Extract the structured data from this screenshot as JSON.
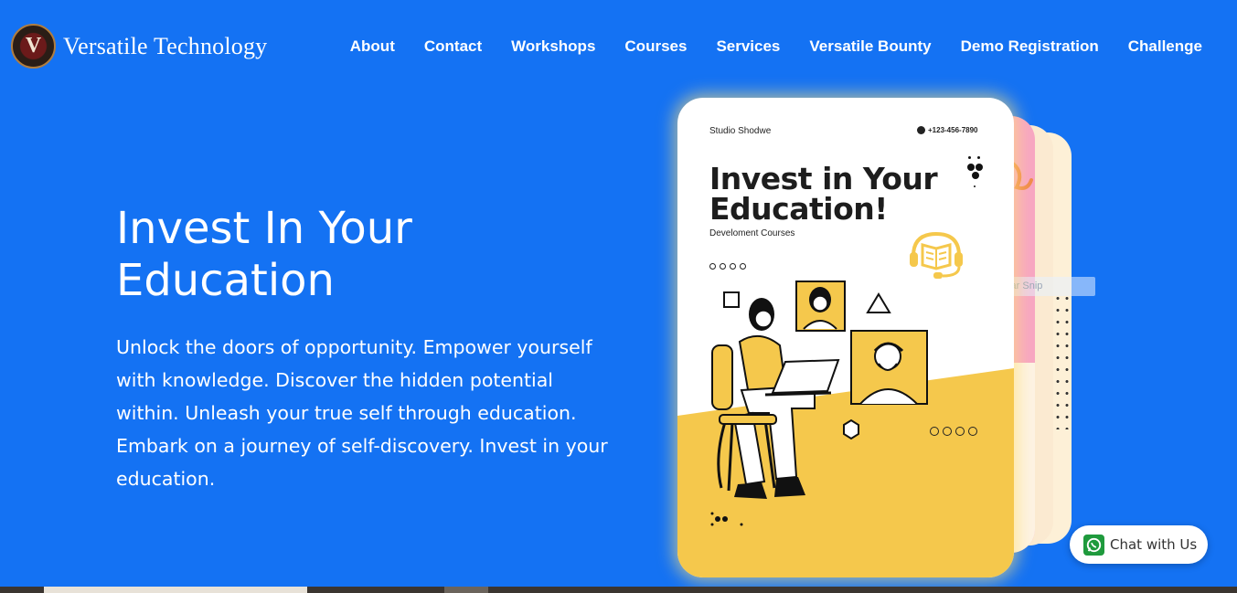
{
  "site": {
    "logo_letter": "V",
    "name": "Versatile Technology"
  },
  "nav": [
    {
      "label": "About"
    },
    {
      "label": "Contact"
    },
    {
      "label": "Workshops"
    },
    {
      "label": "Courses"
    },
    {
      "label": "Services"
    },
    {
      "label": "Versatile Bounty"
    },
    {
      "label": "Demo Registration"
    },
    {
      "label": "Challenge"
    }
  ],
  "hero": {
    "title_line1": "Invest In Your",
    "title_line2": "Education",
    "description": "Unlock the doors of opportunity. Empower yourself with knowledge. Discover the hidden potential within. Unleash your true self through education. Embark on a journey of self-discovery. Invest in your education."
  },
  "card": {
    "studio": "Studio Shodwe",
    "phone": "+123-456-7890",
    "title_line1": "Invest in Your",
    "title_line2": "Education!",
    "subtitle": "Develoment Courses"
  },
  "ghost_tooltip": "Rectangular Snip",
  "chat": {
    "label": "Chat with Us"
  },
  "colors": {
    "background": "#1472f3",
    "card_yellow": "#f5c84c",
    "whatsapp": "#25d366"
  }
}
